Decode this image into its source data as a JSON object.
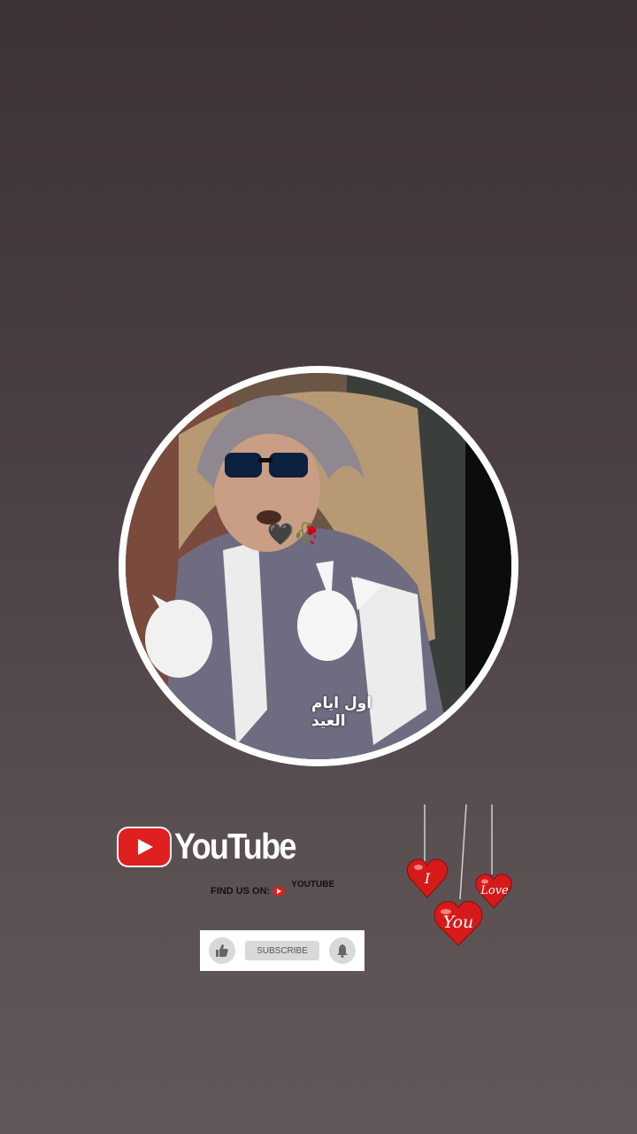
{
  "profile": {
    "caption": "اول ايام العيد",
    "emojis": "🖤🥀"
  },
  "promo": {
    "logo_text": "YouTube",
    "find_us_label": "FIND US ON:",
    "find_us_tag": "YOUTUBE",
    "subscribe_label": "SUBSCRIBE"
  },
  "hearts": {
    "words": [
      "I",
      "Love",
      "You"
    ],
    "color": "#d61a1a"
  },
  "colors": {
    "youtube_red": "#e01f1f",
    "background_top": "#3d3238",
    "background_bottom": "#625859"
  }
}
